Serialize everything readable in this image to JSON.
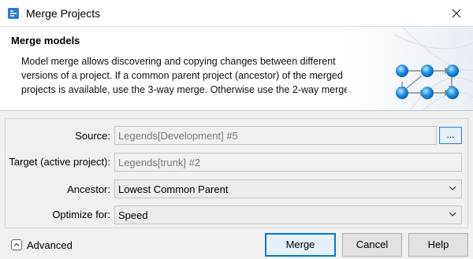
{
  "window": {
    "title": "Merge Projects"
  },
  "banner": {
    "heading": "Merge models",
    "description": "Model merge allows discovering and copying changes between different versions of a project. If a common parent project (ancestor) of the merged projects is available, use the 3-way merge. Otherwise use the 2-way merge."
  },
  "form": {
    "source_label": "Source:",
    "source_value": "Legends[Development] #5",
    "browse_label": "...",
    "target_label": "Target (active project):",
    "target_value": "Legends[trunk] #2",
    "ancestor_label": "Ancestor:",
    "ancestor_value": "Lowest Common Parent",
    "optimize_label": "Optimize for:",
    "optimize_value": "Speed"
  },
  "footer": {
    "advanced_label": "Advanced",
    "merge_label": "Merge",
    "cancel_label": "Cancel",
    "help_label": "Help"
  },
  "colors": {
    "accent": "#0078d7",
    "node_blue": "#1e90e6"
  }
}
